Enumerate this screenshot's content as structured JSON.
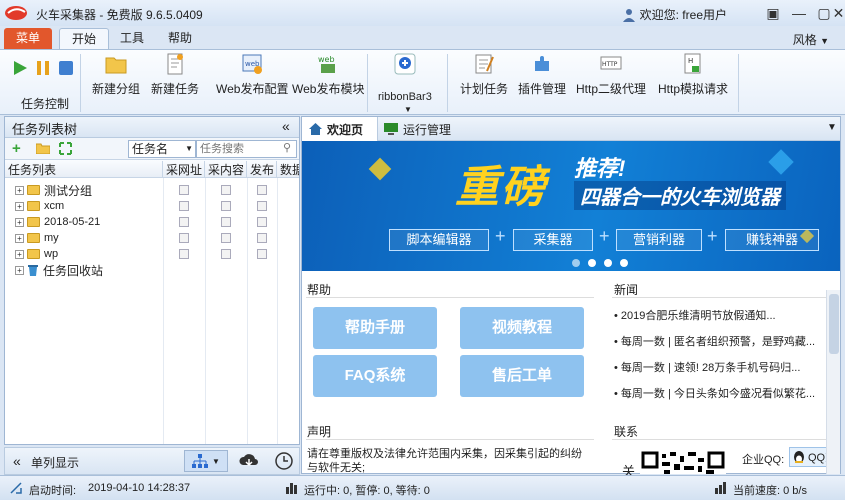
{
  "app": {
    "title": "火车采集器 - 免费版 9.6.5.0409",
    "welcome": "欢迎您: free用户"
  },
  "menu_tabs": [
    "菜单",
    "开始",
    "工具",
    "帮助"
  ],
  "style_menu": "风格",
  "ribbon": {
    "task_control_label": "任务控制",
    "buttons": [
      "新建分组",
      "新建任务",
      "Web发布配置",
      "Web发布模块",
      "ribbonBar3",
      "计划任务",
      "插件管理",
      "Http二级代理",
      "Http模拟请求"
    ]
  },
  "left_panel": {
    "title": "任务列表树",
    "collapse_glyph": "«",
    "search_field": "任务名",
    "search_placeholder": "任务搜索",
    "columns": [
      "任务列表",
      "采网址",
      "采内容",
      "发布",
      "数据"
    ],
    "tree": [
      {
        "label": "测试分组",
        "type": "folder"
      },
      {
        "label": "xcm",
        "type": "folder"
      },
      {
        "label": "2018-05-21",
        "type": "folder"
      },
      {
        "label": "my",
        "type": "folder"
      },
      {
        "label": "wp",
        "type": "folder"
      },
      {
        "label": "任务回收站",
        "type": "trash"
      }
    ],
    "bottom_label": "单列显示"
  },
  "status": {
    "start_label": "启动时间:",
    "start_time": "2019-04-10 14:28:37",
    "run_counts": "运行中: 0, 暂停: 0, 等待: 0",
    "speed": "当前速度: 0 b/s"
  },
  "right_panel": {
    "tabs": [
      "欢迎页",
      "运行管理"
    ],
    "banner": {
      "headline": "重磅",
      "tag": "推荐!",
      "sub": "四器合一的火车浏览器",
      "buttons": [
        "脚本编辑器",
        "采集器",
        "营销利器",
        "赚钱神器"
      ]
    },
    "help": {
      "title": "帮助",
      "buttons": [
        "帮助手册",
        "视频教程",
        "FAQ系统",
        "售后工单"
      ]
    },
    "news": {
      "title": "新闻",
      "items": [
        "2019合肥乐维清明节放假通知...",
        "每周一数 | 匿名者组织预警，是野鸡藏...",
        "每周一数 | 速领! 28万条手机号码归...",
        "每周一数 | 今日头条如今盛况看似繁花..."
      ]
    },
    "statement": {
      "title": "声明",
      "text": "请在尊重版权及法律允许范围内采集，因采集引起的纠纷与软件无关;"
    },
    "contact": {
      "title": "联系",
      "side": "关",
      "qq_label": "企业QQ:",
      "qq_button": "QQ交"
    }
  },
  "colors": {
    "menu_tab": "#e2572c",
    "banner_bg": "#1280d6",
    "help_button": "#8ec2ef",
    "headline": "#ffd21f"
  }
}
